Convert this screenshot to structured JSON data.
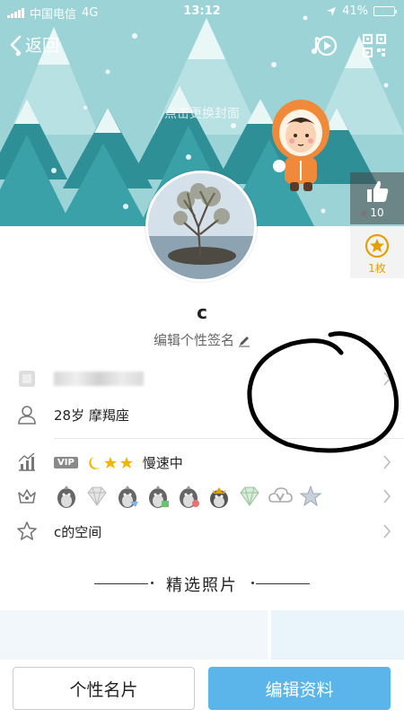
{
  "status_bar": {
    "carrier": "中国电信",
    "network": "4G",
    "time": "13:12",
    "battery": "41%"
  },
  "nav": {
    "back_label": "返回"
  },
  "cover": {
    "hint": "点击更换封面"
  },
  "like": {
    "count": "10"
  },
  "star": {
    "count": "1枚"
  },
  "profile": {
    "name": "c",
    "signature": "编辑个性签名"
  },
  "info": {
    "age_sign": "28岁 摩羯座",
    "vip_label": "VIP",
    "speed_status": "慢速中",
    "space_label": "c的空间"
  },
  "section": {
    "title": "精选照片"
  },
  "buttons": {
    "card": "个性名片",
    "edit": "编辑资料"
  },
  "colors": {
    "banner_bg": "#9bd3d6",
    "accent_blue": "#5bb5ea",
    "gold": "#e2a100"
  }
}
